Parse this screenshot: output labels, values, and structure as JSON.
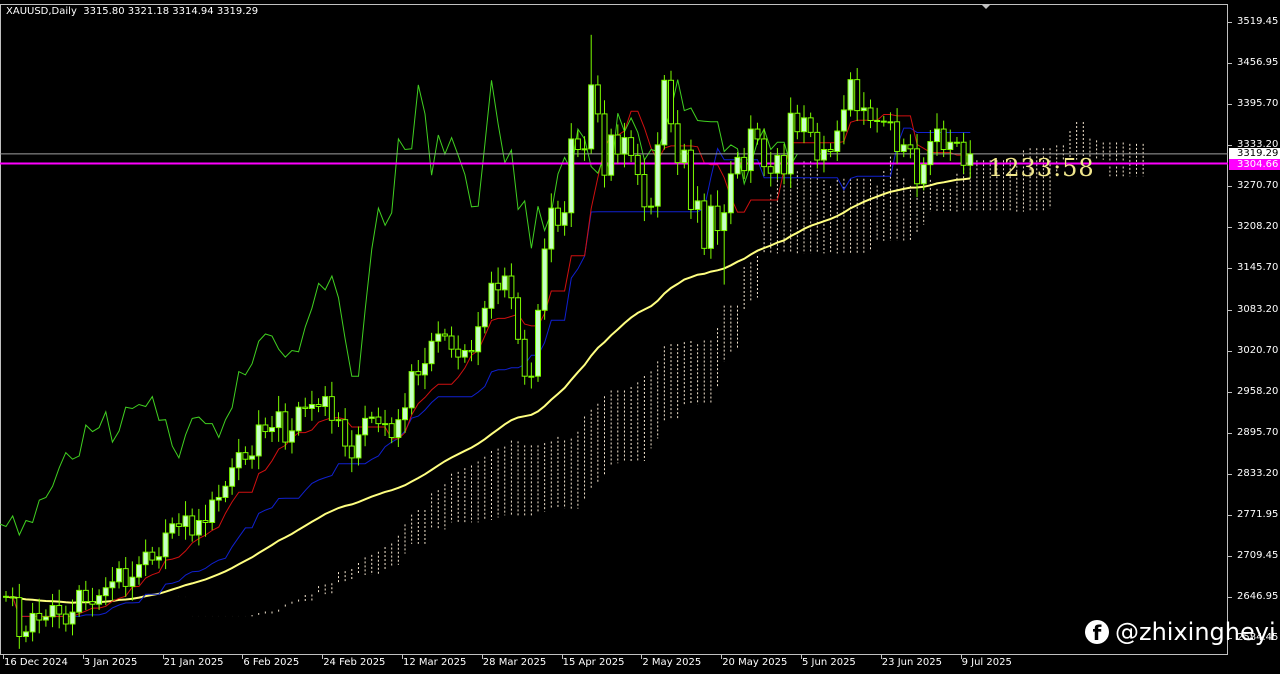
{
  "header": {
    "symbol_period": "XAUUSD,Daily",
    "ohlc": "3315.80 3321.18 3314.94 3319.29"
  },
  "countdown": "1233:58",
  "watermark": {
    "icon": "facebook-icon",
    "handle": "@zhixingheyi"
  },
  "price_labels": {
    "bid": "3319.29",
    "line": "3304.66"
  },
  "colors": {
    "candle": "#7cfc00",
    "bull_fill": "#c8ffc8",
    "tenkan": "#d01010",
    "kijun": "#1020d0",
    "chikou": "#40d020",
    "ma": "#ffff80",
    "cloud_up": "#f5e6d0",
    "cloud_down": "#d2a070",
    "hline": "#ff00ff",
    "bidline": "#a0a0a0"
  },
  "chart_data": {
    "type": "candlestick",
    "title": "XAUUSD,Daily",
    "ylim": [
      2553,
      3532
    ],
    "y_ticks": [
      "3519.45",
      "3456.95",
      "3395.70",
      "3333.20",
      "3270.70",
      "3208.20",
      "3145.70",
      "3083.20",
      "3020.70",
      "2958.20",
      "2895.70",
      "2833.20",
      "2771.95",
      "2709.45",
      "2646.95",
      "2584.45"
    ],
    "x_tick_every_bars": 12,
    "x_ticks": [
      "16 Dec 2024",
      "3 Jan 2025",
      "21 Jan 2025",
      "6 Feb 2025",
      "24 Feb 2025",
      "12 Mar 2025",
      "28 Mar 2025",
      "15 Apr 2025",
      "2 May 2025",
      "20 May 2025",
      "5 Jun 2025",
      "23 Jun 2025",
      "9 Jul 2025"
    ],
    "closes": [
      2647,
      2646,
      2587,
      2594,
      2622,
      2612,
      2617,
      2634,
      2621,
      2606,
      2624,
      2657,
      2640,
      2636,
      2649,
      2661,
      2670,
      2690,
      2663,
      2677,
      2696,
      2715,
      2703,
      2708,
      2744,
      2758,
      2754,
      2770,
      2741,
      2763,
      2760,
      2794,
      2798,
      2815,
      2843,
      2866,
      2856,
      2861,
      2908,
      2898,
      2904,
      2928,
      2882,
      2899,
      2935,
      2933,
      2939,
      2936,
      2951,
      2915,
      2916,
      2876,
      2858,
      2893,
      2918,
      2920,
      2910,
      2910,
      2889,
      2916,
      2934,
      2989,
      2984,
      3001,
      3035,
      3046,
      3043,
      3023,
      3011,
      3021,
      3019,
      3057,
      3085,
      3123,
      3113,
      3134,
      3101,
      3038,
      2982,
      2982,
      3082,
      3175,
      3237,
      3211,
      3230,
      3342,
      3326,
      3327,
      3424,
      3380,
      3287,
      3348,
      3319,
      3344,
      3317,
      3288,
      3239,
      3240,
      3333,
      3431,
      3365,
      3306,
      3325,
      3235,
      3248,
      3176,
      3240,
      3203,
      3230,
      3289,
      3314,
      3294,
      3357,
      3342,
      3300,
      3290,
      3317,
      3289,
      3381,
      3353,
      3374,
      3352,
      3310,
      3326,
      3323,
      3354,
      3386,
      3432,
      3385,
      3389,
      3370,
      3369,
      3368,
      3368,
      3323,
      3333,
      3327,
      3274,
      3303,
      3338,
      3357,
      3326,
      3337,
      3337,
      3302,
      3319.29
    ],
    "first_open": 2648,
    "hlines": [
      3319.29,
      3304.66
    ],
    "indicators": [
      "Ichimoku 9/26/52",
      "Moving Average 60"
    ]
  }
}
